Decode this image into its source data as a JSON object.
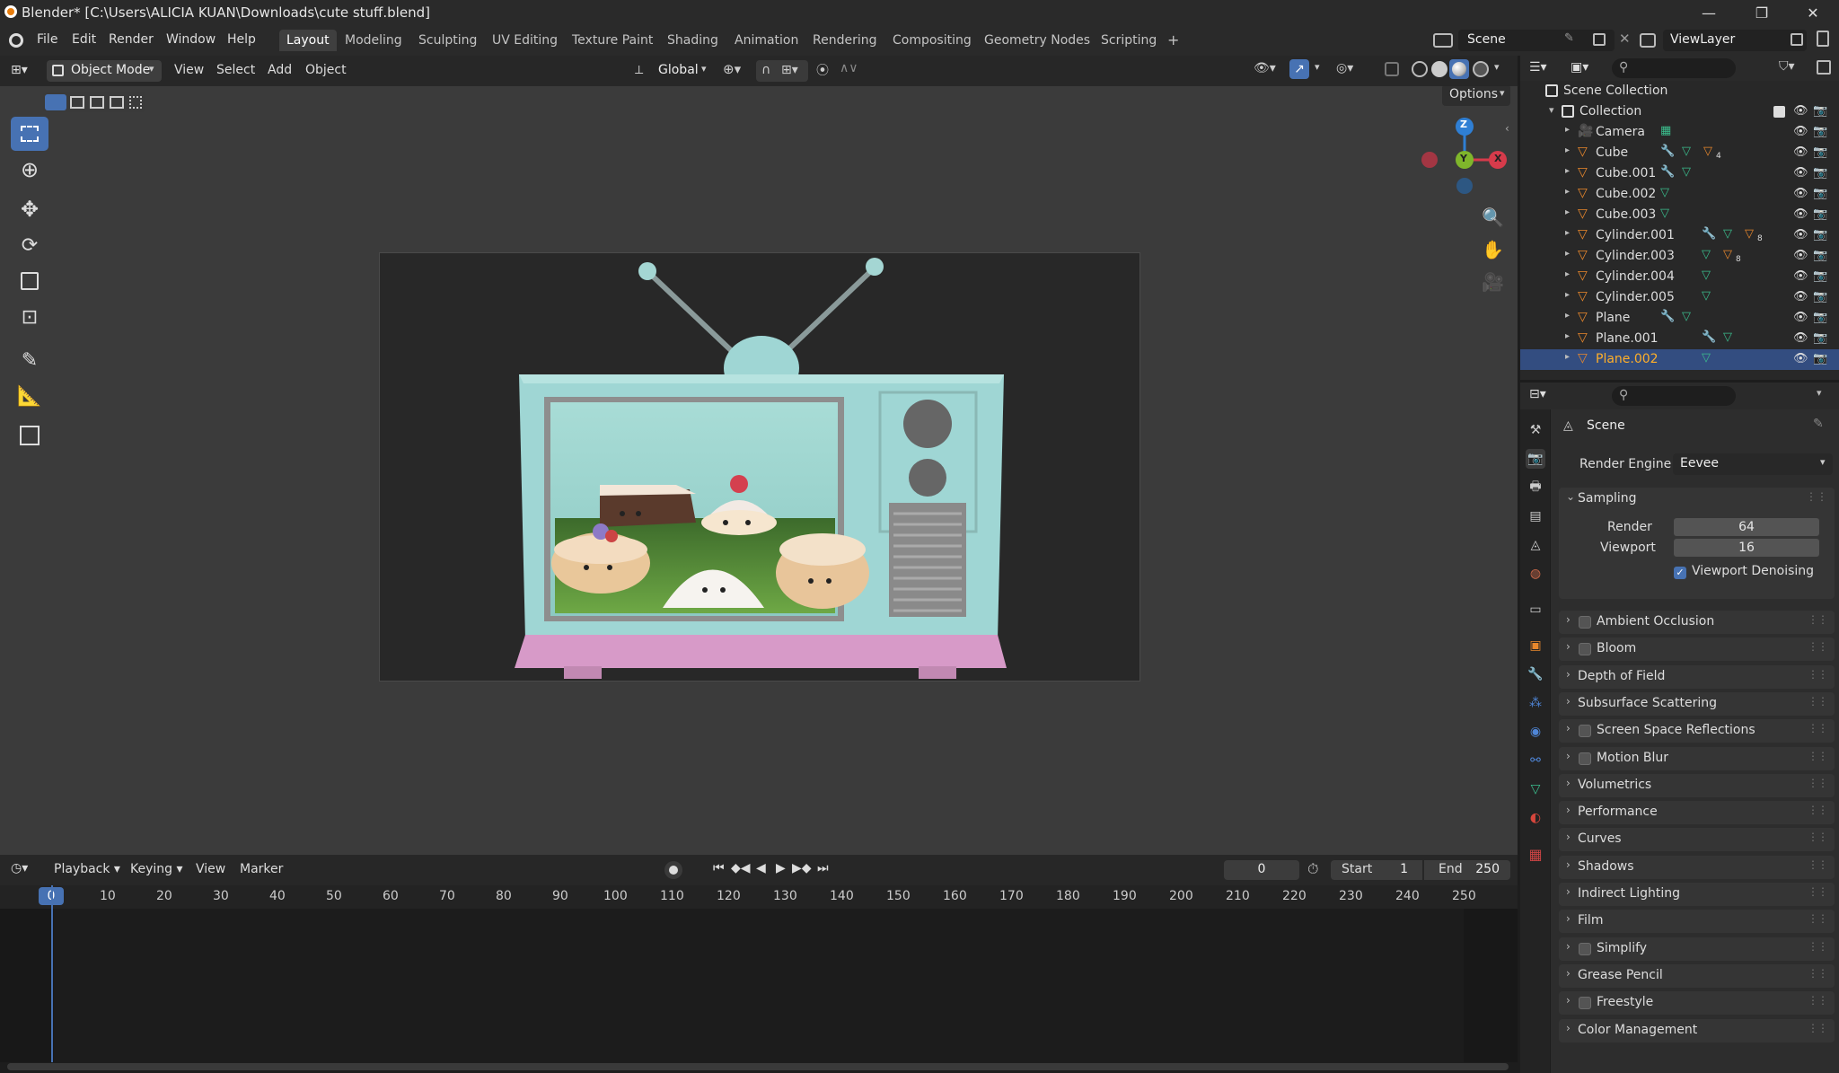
{
  "window": {
    "title": "Blender* [C:\\Users\\ALICIA KUAN\\Downloads\\cute stuff.blend]",
    "minimize_glyph": "—",
    "maximize_glyph": "❐",
    "close_glyph": "✕"
  },
  "menubar": {
    "menus": [
      "File",
      "Edit",
      "Render",
      "Window",
      "Help"
    ],
    "workspaces": [
      "Layout",
      "Modeling",
      "Sculpting",
      "UV Editing",
      "Texture Paint",
      "Shading",
      "Animation",
      "Rendering",
      "Compositing",
      "Geometry Nodes",
      "Scripting"
    ],
    "active_workspace": "Layout",
    "add_workspace": "+",
    "scene_name": "Scene",
    "view_layer": "ViewLayer"
  },
  "viewport_header": {
    "mode": "Object Mode",
    "menus": [
      "View",
      "Select",
      "Add",
      "Object"
    ],
    "orientation": "Global",
    "options": "Options"
  },
  "gizmo": {
    "x": "X",
    "y": "Y",
    "z": "Z"
  },
  "timeline": {
    "menus": [
      "Playback",
      "Keying",
      "View",
      "Marker"
    ],
    "current_frame": "0",
    "start_label": "Start",
    "start": "1",
    "end_label": "End",
    "end": "250",
    "current_marker": "0",
    "ruler_labels": [
      "10",
      "20",
      "30",
      "40",
      "50",
      "60",
      "70",
      "80",
      "90",
      "100",
      "110",
      "120",
      "130",
      "140",
      "150",
      "160",
      "170",
      "180",
      "190",
      "200",
      "210",
      "220",
      "230",
      "240",
      "250"
    ]
  },
  "outliner": {
    "scene_collection": "Scene Collection",
    "collection": "Collection",
    "items": [
      {
        "name": "Camera",
        "badge": ""
      },
      {
        "name": "Cube",
        "badge": "4"
      },
      {
        "name": "Cube.001",
        "badge": ""
      },
      {
        "name": "Cube.002",
        "badge": ""
      },
      {
        "name": "Cube.003",
        "badge": ""
      },
      {
        "name": "Cylinder.001",
        "badge": "8"
      },
      {
        "name": "Cylinder.003",
        "badge": "8"
      },
      {
        "name": "Cylinder.004",
        "badge": ""
      },
      {
        "name": "Cylinder.005",
        "badge": ""
      },
      {
        "name": "Plane",
        "badge": ""
      },
      {
        "name": "Plane.001",
        "badge": ""
      },
      {
        "name": "Plane.002",
        "badge": ""
      }
    ],
    "selected": "Plane.002"
  },
  "properties": {
    "context": "Scene",
    "render_engine_label": "Render Engine",
    "render_engine": "Eevee",
    "sampling": {
      "title": "Sampling",
      "render_label": "Render",
      "render": "64",
      "viewport_label": "Viewport",
      "viewport": "16",
      "denoise_label": "Viewport Denoising",
      "denoise_checked": true
    },
    "panels": [
      {
        "label": "Ambient Occlusion",
        "checkbox": true
      },
      {
        "label": "Bloom",
        "checkbox": true
      },
      {
        "label": "Depth of Field",
        "checkbox": false
      },
      {
        "label": "Subsurface Scattering",
        "checkbox": false
      },
      {
        "label": "Screen Space Reflections",
        "checkbox": true
      },
      {
        "label": "Motion Blur",
        "checkbox": true
      },
      {
        "label": "Volumetrics",
        "checkbox": false
      },
      {
        "label": "Performance",
        "checkbox": false
      },
      {
        "label": "Curves",
        "checkbox": false
      },
      {
        "label": "Shadows",
        "checkbox": false
      },
      {
        "label": "Indirect Lighting",
        "checkbox": false
      },
      {
        "label": "Film",
        "checkbox": false
      },
      {
        "label": "Simplify",
        "checkbox": true
      },
      {
        "label": "Grease Pencil",
        "checkbox": false
      },
      {
        "label": "Freestyle",
        "checkbox": true
      },
      {
        "label": "Color Management",
        "checkbox": false
      }
    ]
  },
  "colors": {
    "accent_blue": "#4772b3",
    "selected_row": "#334d80",
    "tv_body": "#9fd6d4",
    "tv_stand": "#d79ac8",
    "axis_x": "#d63b4b",
    "axis_y": "#7fb62b",
    "axis_z": "#2f7fd4"
  }
}
